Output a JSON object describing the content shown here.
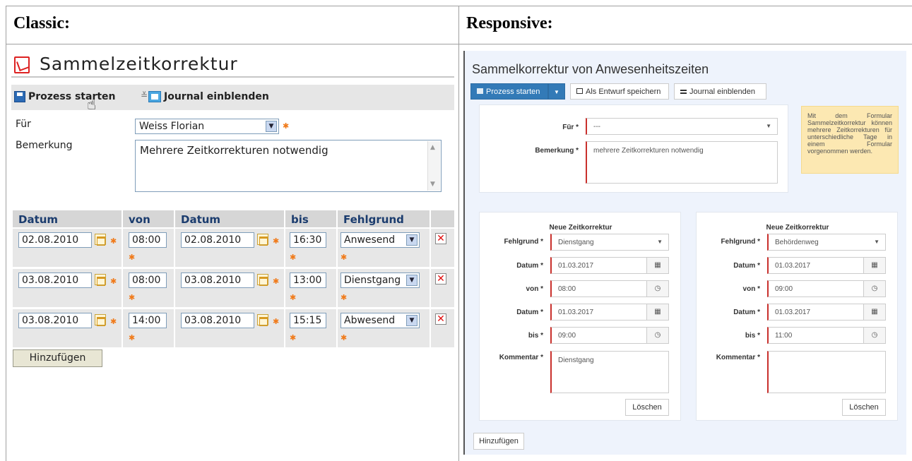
{
  "headers": {
    "classic": "Classic:",
    "responsive": "Responsive:"
  },
  "classic": {
    "title": "Sammelzeitkorrektur",
    "toolbar": {
      "start": "Prozess starten",
      "journal": "Journal einblenden"
    },
    "form": {
      "fuer_label": "Für",
      "fuer_value": "Weiss Florian",
      "bemerkung_label": "Bemerkung",
      "bemerkung_value": "Mehrere Zeitkorrekturen notwendig"
    },
    "table": {
      "headers": [
        "Datum",
        "von",
        "Datum",
        "bis",
        "Fehlgrund"
      ],
      "rows": [
        {
          "date_from": "02.08.2010",
          "von": "08:00",
          "date_to": "02.08.2010",
          "bis": "16:30",
          "grund": "Anwesend"
        },
        {
          "date_from": "03.08.2010",
          "von": "08:00",
          "date_to": "03.08.2010",
          "bis": "13:00",
          "grund": "Dienstgang"
        },
        {
          "date_from": "03.08.2010",
          "von": "14:00",
          "date_to": "03.08.2010",
          "bis": "15:15",
          "grund": "Abwesend"
        }
      ]
    },
    "add_button": "Hinzufügen"
  },
  "responsive": {
    "title": "Sammelkorrektur von Anwesenheitszeiten",
    "toolbar": {
      "start": "Prozess starten",
      "draft": "Als Entwurf speichern",
      "journal": "Journal einblenden"
    },
    "form": {
      "fuer_label": "Für *",
      "fuer_value": "---",
      "bemerkung_label": "Bemerkung *",
      "bemerkung_value": "mehrere Zeitkorrekturen notwendig"
    },
    "hint": "Mit dem Formular Sammelzeitkorrektur können mehrere Zeitkorrekturen für unterschiedliche Tage in einem Formular vorgenommen werden.",
    "cards": [
      {
        "heading": "Neue Zeitkorrektur",
        "fehlgrund_label": "Fehlgrund *",
        "fehlgrund": "Dienstgang",
        "datum1_label": "Datum *",
        "datum1": "01.03.2017",
        "von_label": "von *",
        "von": "08:00",
        "datum2_label": "Datum *",
        "datum2": "01.03.2017",
        "bis_label": "bis *",
        "bis": "09:00",
        "kommentar_label": "Kommentar *",
        "kommentar": "Dienstgang",
        "delete": "Löschen"
      },
      {
        "heading": "Neue Zeitkorrektur",
        "fehlgrund_label": "Fehlgrund *",
        "fehlgrund": "Behördenweg",
        "datum1_label": "Datum *",
        "datum1": "01.03.2017",
        "von_label": "von *",
        "von": "09:00",
        "datum2_label": "Datum *",
        "datum2": "01.03.2017",
        "bis_label": "bis *",
        "bis": "11:00",
        "kommentar_label": "Kommentar *",
        "kommentar": "",
        "delete": "Löschen"
      }
    ],
    "add_button": "Hinzufügen"
  }
}
